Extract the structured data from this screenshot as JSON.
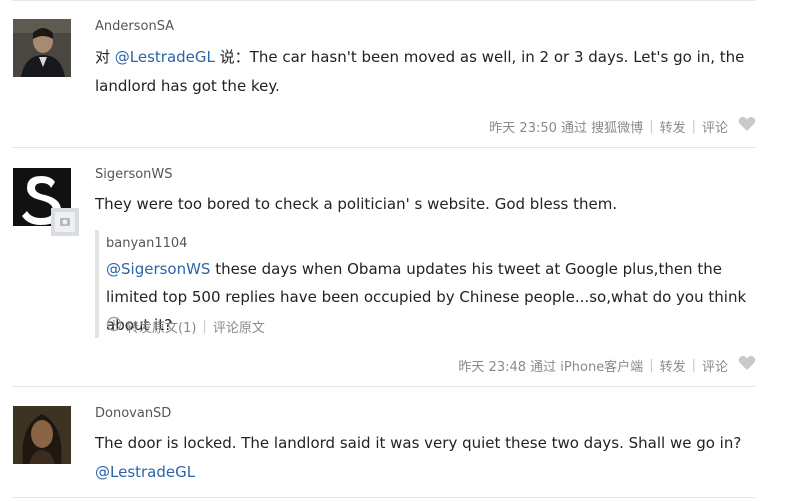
{
  "posts": [
    {
      "username": "AndersonSA",
      "prefix": "对 ",
      "mention": "@LestradeGL",
      "text_after_mention": " 说：The car hasn't been moved as well, in 2 or 3 days. Let's go in, the landlord has got the key.",
      "time": "昨天 23:50",
      "via": "通过 搜狐微博",
      "repost_label": "转发",
      "comment_label": "评论",
      "like_icon": "heart-icon"
    },
    {
      "username": "SigersonWS",
      "text": "They were too bored to check a politician' s website. God bless them.",
      "quoted": {
        "username": "banyan1104",
        "mention": "@SigersonWS",
        "text_after_mention": " these days when Obama updates his tweet at Google plus,then the limited top 500 replies have been occupied by Chinese people...so,what do you think about it?",
        "repost_original": "转发原文(1)",
        "comment_original": "评论原文"
      },
      "time": "昨天 23:48",
      "via": "通过 iPhone客户端",
      "repost_label": "转发",
      "comment_label": "评论",
      "like_icon": "heart-icon"
    },
    {
      "username": "DonovanSD",
      "text": "The door is locked. The landlord said it was very quiet these two days. Shall we go in?",
      "mention": "@LestradeGL"
    }
  ],
  "colors": {
    "link": "#2b64a8",
    "meta": "#8a8a8a",
    "heart": "#c9c9c9",
    "divider": "#e6e6e6"
  }
}
